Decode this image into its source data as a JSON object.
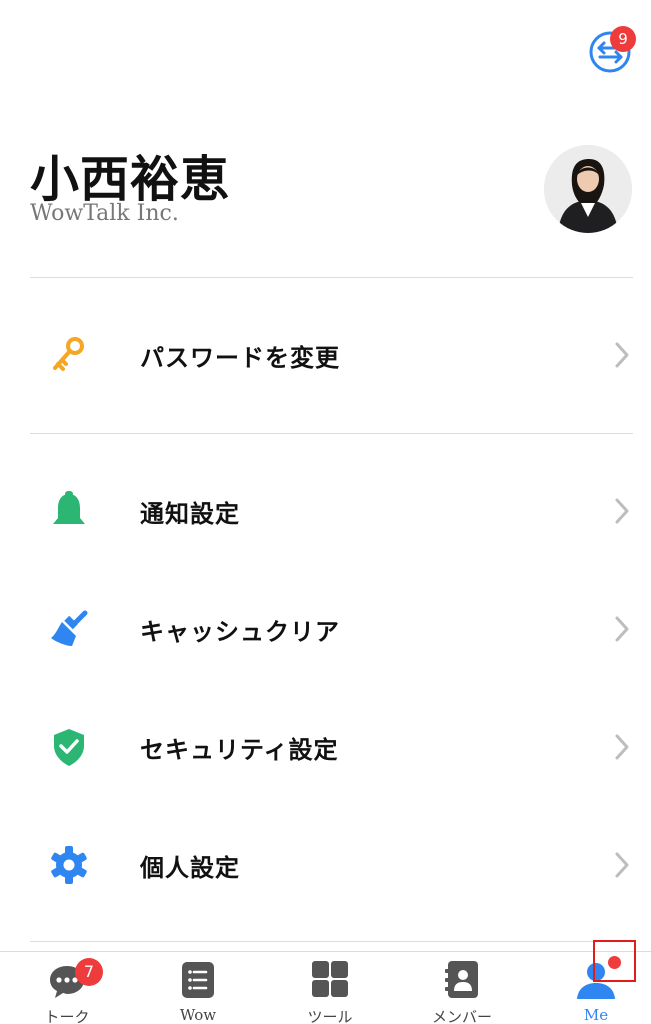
{
  "colors": {
    "accent": "#2f86f0",
    "badge": "#ee3b3b",
    "key_icon": "#f5a623",
    "green_icon": "#2bb673",
    "blue_icon": "#2f86f0"
  },
  "header": {
    "switch_icon": "switch-arrows-icon",
    "switch_badge": "9"
  },
  "profile": {
    "name": "小西裕恵",
    "company": "WowTalk Inc."
  },
  "menu": {
    "items": [
      {
        "label": "パスワードを変更",
        "icon": "key-icon"
      },
      {
        "label": "通知設定",
        "icon": "bell-icon"
      },
      {
        "label": "キャッシュクリア",
        "icon": "broom-icon"
      },
      {
        "label": "セキュリティ設定",
        "icon": "shield-check-icon"
      },
      {
        "label": "個人設定",
        "icon": "gear-icon"
      }
    ]
  },
  "tabbar": {
    "tabs": [
      {
        "label": "トーク",
        "icon": "chat-bubble-icon",
        "badge": "7"
      },
      {
        "label": "Wow",
        "icon": "list-icon"
      },
      {
        "label": "ツール",
        "icon": "grid-icon"
      },
      {
        "label": "メンバー",
        "icon": "contacts-icon"
      },
      {
        "label": "Me",
        "icon": "person-icon",
        "active": true
      }
    ]
  }
}
